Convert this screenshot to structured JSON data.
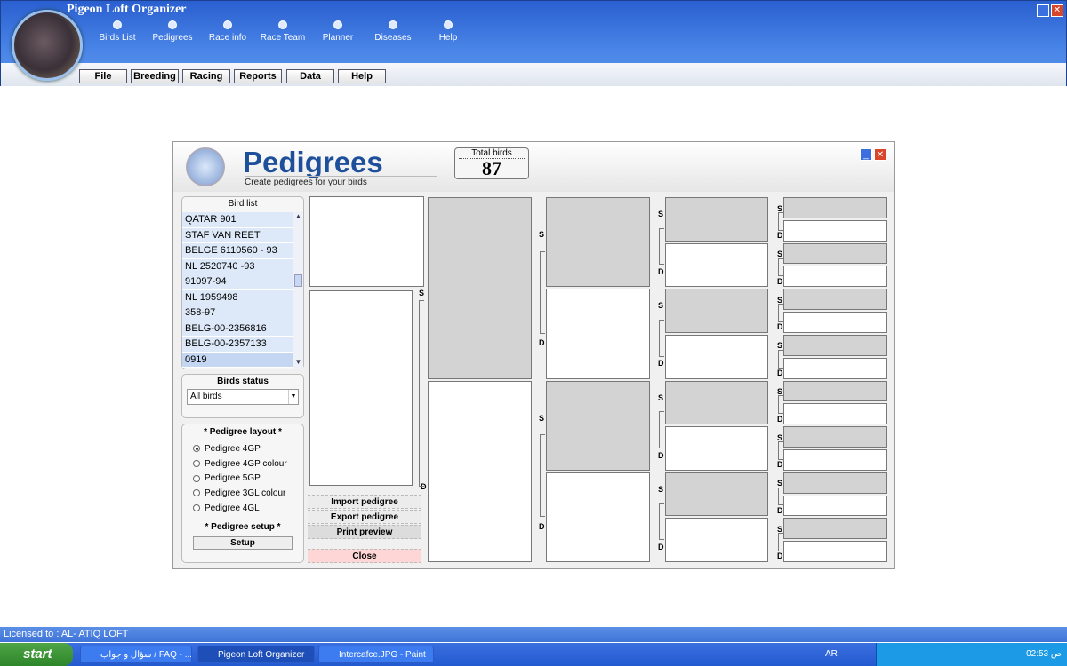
{
  "app": {
    "title": "Pigeon Loft Organizer"
  },
  "nav": [
    {
      "label": "Birds List"
    },
    {
      "label": "Pedigrees"
    },
    {
      "label": "Race info"
    },
    {
      "label": "Race Team"
    },
    {
      "label": "Planner"
    },
    {
      "label": "Diseases"
    },
    {
      "label": "Help"
    }
  ],
  "menu": [
    {
      "label": "File"
    },
    {
      "label": "Breeding"
    },
    {
      "label": "Racing"
    },
    {
      "label": "Reports"
    },
    {
      "label": "Data"
    },
    {
      "label": "Help"
    }
  ],
  "window": {
    "title": "Pedigrees",
    "subtitle": "Create pedigrees for your birds",
    "total_label": "Total birds",
    "total_value": "87"
  },
  "bird_list": {
    "header": "Bird list",
    "items": [
      "QATAR 901",
      "STAF VAN REET",
      "BELGE 6110560 - 93",
      "NL 2520740 -93",
      "91097-94",
      "NL 1959498",
      "358-97",
      "BELG-00-2356816",
      "BELG-00-2357133",
      "0919"
    ],
    "selected_index": 9
  },
  "birds_status": {
    "label": "Birds status",
    "value": "All birds"
  },
  "layout": {
    "label": "* Pedigree layout *",
    "options": [
      "Pedigree 4GP",
      "Pedigree 4GP colour",
      "Pedigree 5GP",
      "Pedigree 3GL colour",
      "Pedigree 4GL"
    ],
    "selected": "Pedigree 4GP"
  },
  "setup": {
    "label": "* Pedigree setup *",
    "button": "Setup"
  },
  "actions": {
    "import": "Import pedigree",
    "export": "Export pedigree",
    "print": "Print preview",
    "close": "Close"
  },
  "labels": {
    "sire": "S",
    "dam": "D"
  },
  "status_bar": "Licensed to : AL- ATIQ LOFT",
  "taskbar": {
    "start": "start",
    "tasks": [
      "سؤال و جواب / FAQ - ...",
      "Pigeon Loft Organizer",
      "Intercafce.JPG - Paint"
    ],
    "lang": "AR",
    "clock": "02:53 ص"
  },
  "colors": {
    "accent": "#1e4f9a",
    "header": "#3f74d8",
    "close_button": "#ffd6d6"
  }
}
